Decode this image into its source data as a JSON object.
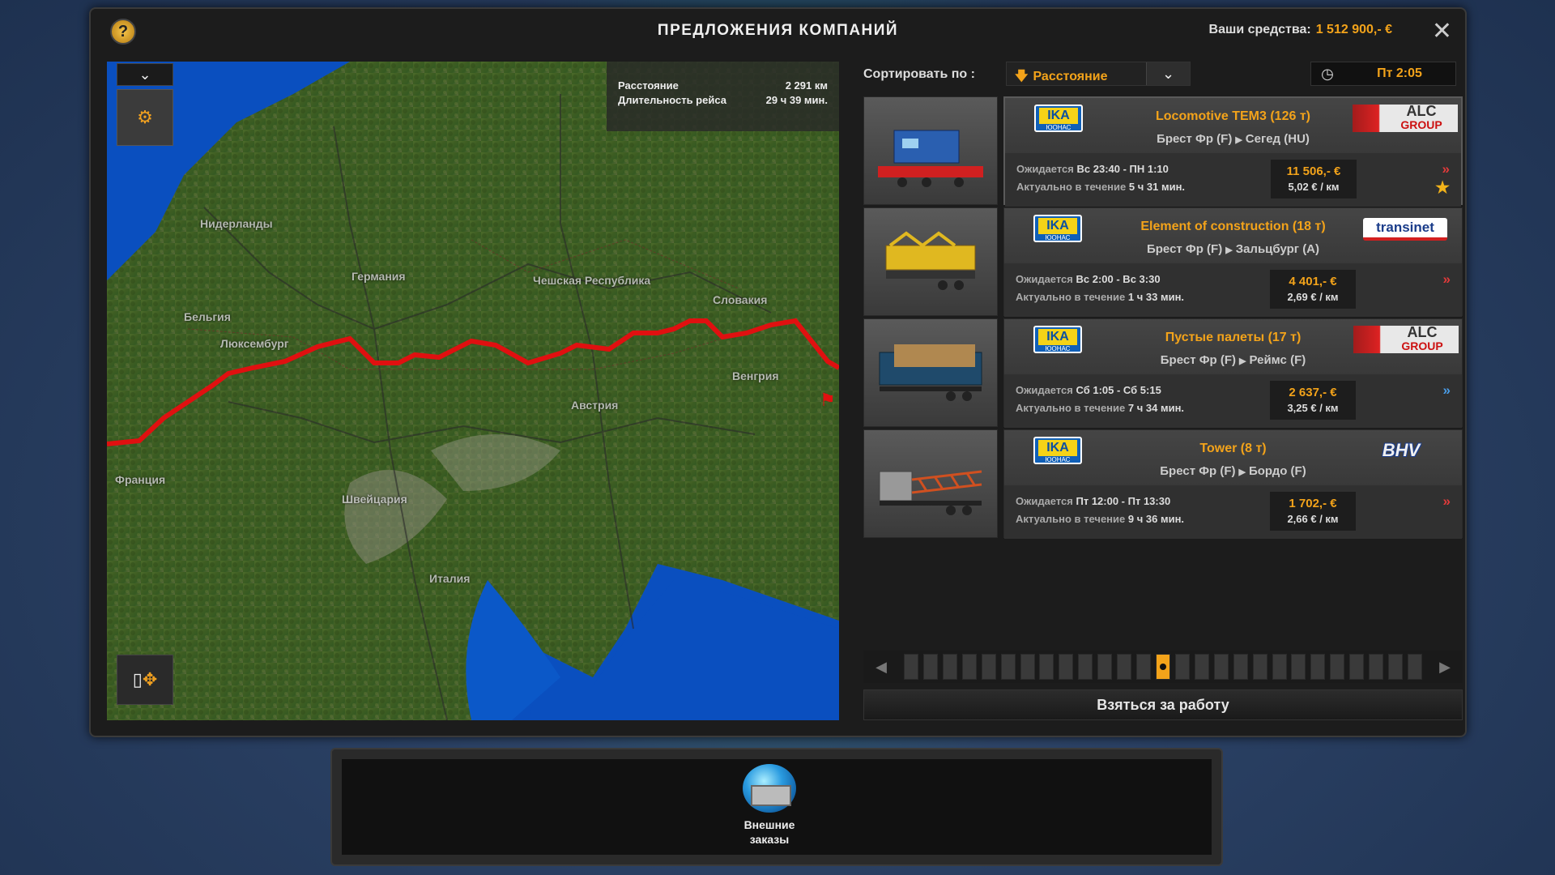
{
  "header": {
    "title": "ПРЕДЛОЖЕНИЯ КОМПАНИЙ",
    "funds_label": "Ваши средства:",
    "funds_value": "1 512 900,- €",
    "help": "?",
    "close": "✕"
  },
  "map": {
    "info": {
      "distance_label": "Расстояние",
      "distance_value": "2 291 км",
      "duration_label": "Длительность рейса",
      "duration_value": "29 ч 39 мин."
    },
    "labels": [
      "Нидерланды",
      "Германия",
      "Чешская Республика",
      "Словакия",
      "Бельгия",
      "Люксембург",
      "Венгрия",
      "Австрия",
      "Франция",
      "Швейцария",
      "Италия"
    ]
  },
  "sort": {
    "label": "Сортировать по :",
    "value": "Расстояние",
    "time": "Пт 2:05"
  },
  "jobs": [
    {
      "cargo": "Locomotive TEM3 (126 т)",
      "from": "Брест Фр (F)",
      "to": "Сегед (HU)",
      "wait_label": "Ожидается",
      "wait": "Вс 23:40 - ПН 1:10",
      "valid_label": "Актуально в течение",
      "valid": "5 ч 31 мин.",
      "price": "11 506,- €",
      "per_km": "5,02 € / км",
      "company": "ALC",
      "company_sub": "GROUP",
      "urgency": "red",
      "starred": true
    },
    {
      "cargo": "Element of construction (18 т)",
      "from": "Брест Фр (F)",
      "to": "Зальцбург (A)",
      "wait_label": "Ожидается",
      "wait": "Вс 2:00 - Вс 3:30",
      "valid_label": "Актуально в течение",
      "valid": "1 ч 33 мин.",
      "price": "4 401,- €",
      "per_km": "2,69 € / км",
      "company": "transinet",
      "urgency": "red"
    },
    {
      "cargo": "Пустые палеты (17 т)",
      "from": "Брест Фр (F)",
      "to": "Реймс (F)",
      "wait_label": "Ожидается",
      "wait": "Сб 1:05 - Сб 5:15",
      "valid_label": "Актуально в течение",
      "valid": "7 ч 34 мин.",
      "price": "2 637,- €",
      "per_km": "3,25 € / км",
      "company": "ALC",
      "company_sub": "GROUP",
      "urgency": "blue"
    },
    {
      "cargo": "Tower (8 т)",
      "from": "Брест Фр (F)",
      "to": "Бордо (F)",
      "wait_label": "Ожидается",
      "wait": "Пт 12:00 - Пт 13:30",
      "valid_label": "Актуально в течение",
      "valid": "9 ч 36 мин.",
      "price": "1 702,- €",
      "per_km": "2,66 € / км",
      "company": "BHV",
      "urgency": "red"
    }
  ],
  "employer_logo": {
    "line1": "IKA",
    "line2": "ЮОНАС"
  },
  "pager": {
    "total": 27,
    "current": 14
  },
  "take_button": "Взяться за работу",
  "dock": {
    "item_label_1": "Внешние",
    "item_label_2": "заказы"
  },
  "colors": {
    "accent": "#f3a31a",
    "route": "#e01010",
    "sea": "#0a4fbf"
  }
}
